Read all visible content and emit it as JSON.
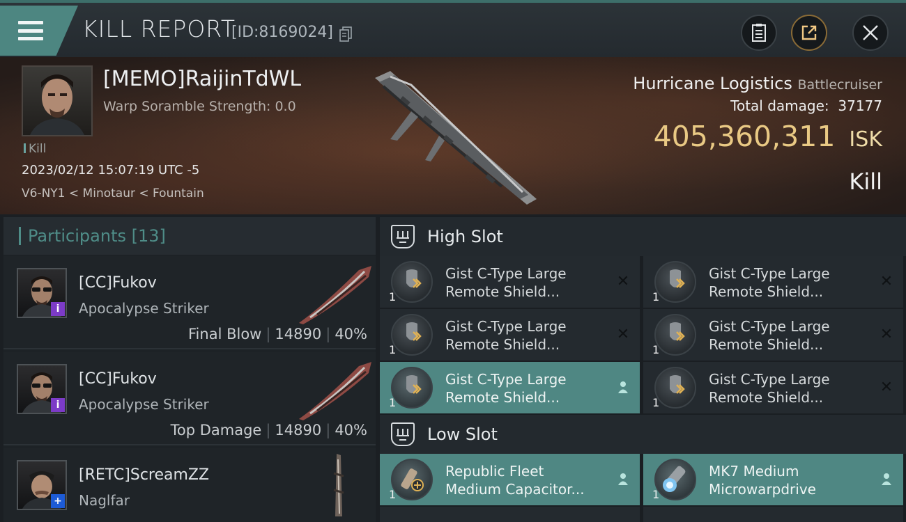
{
  "titlebar": {
    "title": "KILL REPORT",
    "kill_id": "[ID:8169024]",
    "buttons": [
      "report-icon",
      "share-icon",
      "close-icon"
    ]
  },
  "victim": {
    "name": "[MEMO]RaijinTdWL",
    "warp": "Warp Soramble Strength: 0.0",
    "tag": "Kill",
    "datetime": "2023/02/12 15:07:19 UTC -5",
    "location": "V6-NY1 < Minotaur < Fountain",
    "ship_name": "Hurricane Logistics",
    "ship_class": "Battlecruiser",
    "total_damage_label": "Total damage:",
    "total_damage": "37177",
    "isk_value": "405,360,311",
    "isk_unit": "ISK",
    "result": "Kill"
  },
  "participants": {
    "label": "Participants",
    "count": "[13]",
    "rows": [
      {
        "name": "[CC]Fukov",
        "ship": "Apocalypse Striker",
        "role": "Final Blow",
        "damage": "14890",
        "pct": "40%",
        "badge": "i"
      },
      {
        "name": "[CC]Fukov",
        "ship": "Apocalypse Striker",
        "role": "Top Damage",
        "damage": "14890",
        "pct": "40%",
        "badge": "i"
      },
      {
        "name": "[RETC]ScreamZZ",
        "ship": "Naglfar",
        "role": "",
        "damage": "",
        "pct": "",
        "badge": "+"
      }
    ]
  },
  "fitting": {
    "high_slot": "High Slot",
    "low_slot": "Low Slot",
    "high": [
      {
        "qty": "1",
        "line1": "Gist C-Type Large",
        "line2": "Remote Shield...",
        "state": "x"
      },
      {
        "qty": "1",
        "line1": "Gist C-Type Large",
        "line2": "Remote Shield...",
        "state": "x"
      },
      {
        "qty": "1",
        "line1": "Gist C-Type Large",
        "line2": "Remote Shield...",
        "state": "x"
      },
      {
        "qty": "1",
        "line1": "Gist C-Type Large",
        "line2": "Remote Shield...",
        "state": "x"
      },
      {
        "qty": "1",
        "line1": "Gist C-Type Large",
        "line2": "Remote Shield...",
        "state": "person"
      },
      {
        "qty": "1",
        "line1": "Gist C-Type Large",
        "line2": "Remote Shield...",
        "state": "x"
      }
    ],
    "low": [
      {
        "qty": "1",
        "line1": "Republic Fleet",
        "line2": "Medium Capacitor...",
        "state": "person"
      },
      {
        "qty": "1",
        "line1": "MK7 Medium",
        "line2": "Microwarpdrive",
        "state": "person"
      }
    ]
  },
  "colors": {
    "accent": "#4f8783",
    "isk": "#e9c984",
    "purple_badge": "#7c3bc7",
    "blue_badge": "#1d5bd6"
  }
}
